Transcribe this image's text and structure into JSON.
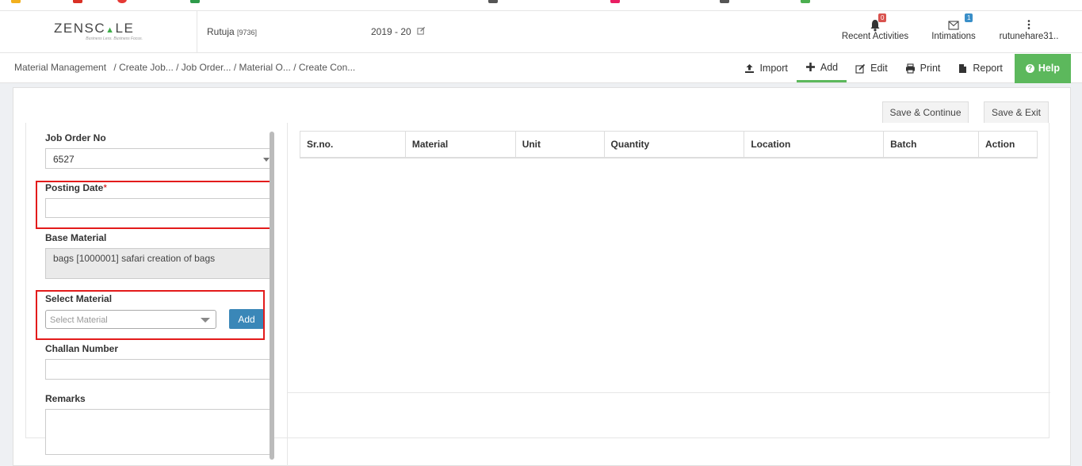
{
  "header": {
    "logo_text_a": "ZENSC",
    "logo_text_b": "▲",
    "logo_text_c": "LE",
    "logo_tagline": "Business Less. Business Focus.",
    "user_name": "Rutuja",
    "user_id": "[9736]",
    "year": "2019 - 20",
    "recent_activities": {
      "label": "Recent Activities",
      "count": "0"
    },
    "intimations": {
      "label": "Intimations",
      "count": "1"
    },
    "profile": {
      "label": "rutunehare31.."
    }
  },
  "breadcrumb": {
    "root": "Material Management",
    "items": [
      "/ Create Job...",
      "/ Job Order...",
      "/ Material O...",
      "/ Create Con..."
    ]
  },
  "toolbar": {
    "import": "Import",
    "add": "Add",
    "edit": "Edit",
    "print": "Print",
    "report": "Report",
    "help": "Help"
  },
  "actions": {
    "save_continue": "Save & Continue",
    "save_exit": "Save & Exit"
  },
  "form": {
    "job_order_no": {
      "label": "Job Order No",
      "value": "6527"
    },
    "posting_date": {
      "label": "Posting Date",
      "required_mark": "*",
      "value": ""
    },
    "base_material": {
      "label": "Base Material",
      "value": "bags [1000001] safari creation of bags"
    },
    "select_material": {
      "label": "Select Material",
      "placeholder": "Select Material",
      "add_label": "Add"
    },
    "challan_number": {
      "label": "Challan Number",
      "value": ""
    },
    "remarks": {
      "label": "Remarks",
      "value": ""
    }
  },
  "table": {
    "columns": [
      "Sr.no.",
      "Material",
      "Unit",
      "Quantity",
      "Location",
      "Batch",
      "Action"
    ],
    "rows": []
  },
  "colors": {
    "accent_green": "#5cb85c",
    "add_button_blue": "#3a87b8",
    "highlight_red": "#e31b1b",
    "badge_red": "#d9534f",
    "badge_blue": "#3a8fc8"
  }
}
